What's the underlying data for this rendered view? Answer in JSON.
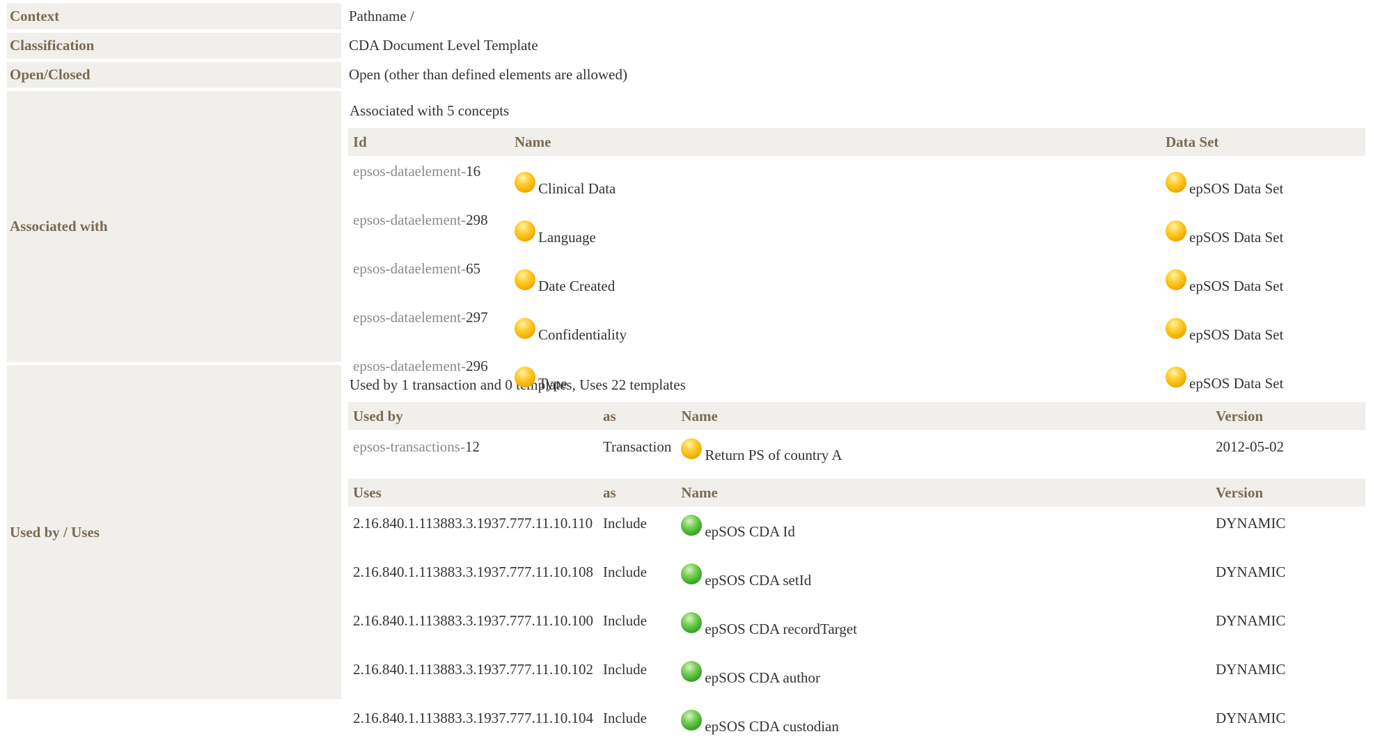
{
  "context": {
    "label": "Context",
    "value": "Pathname /"
  },
  "classification": {
    "label": "Classification",
    "value": "CDA Document Level Template"
  },
  "open_closed": {
    "label": "Open/Closed",
    "value": "Open (other than defined elements are allowed)"
  },
  "associated": {
    "label": "Associated with",
    "intro": "Associated with 5 concepts",
    "headers": {
      "id": "Id",
      "name": "Name",
      "dataset": "Data Set"
    },
    "rows": [
      {
        "id_prefix": "epsos-dataelement-",
        "id_num": "16",
        "name": "Clinical Data",
        "dataset": "epSOS Data Set"
      },
      {
        "id_prefix": "epsos-dataelement-",
        "id_num": "298",
        "name": "Language",
        "dataset": "epSOS Data Set"
      },
      {
        "id_prefix": "epsos-dataelement-",
        "id_num": "65",
        "name": "Date Created",
        "dataset": "epSOS Data Set"
      },
      {
        "id_prefix": "epsos-dataelement-",
        "id_num": "297",
        "name": "Confidentiality",
        "dataset": "epSOS Data Set"
      },
      {
        "id_prefix": "epsos-dataelement-",
        "id_num": "296",
        "name": "Type",
        "dataset": "epSOS Data Set"
      }
    ]
  },
  "used_by_uses": {
    "label": "Used by / Uses",
    "intro": "Used by 1 transaction and 0 templates, Uses 22 templates",
    "used_by_headers": {
      "col1": "Used by",
      "as": "as",
      "name": "Name",
      "version": "Version"
    },
    "used_by_rows": [
      {
        "id_prefix": "epsos-transactions-",
        "id_num": "12",
        "as": "Transaction",
        "name": "Return PS of country A",
        "version": "2012-05-02"
      }
    ],
    "uses_headers": {
      "col1": "Uses",
      "as": "as",
      "name": "Name",
      "version": "Version"
    },
    "uses_rows": [
      {
        "id": "2.16.840.1.113883.3.1937.777.11.10.110",
        "as": "Include",
        "name": "epSOS CDA Id",
        "version": "DYNAMIC"
      },
      {
        "id": "2.16.840.1.113883.3.1937.777.11.10.108",
        "as": "Include",
        "name": "epSOS CDA setId",
        "version": "DYNAMIC"
      },
      {
        "id": "2.16.840.1.113883.3.1937.777.11.10.100",
        "as": "Include",
        "name": "epSOS CDA recordTarget",
        "version": "DYNAMIC"
      },
      {
        "id": "2.16.840.1.113883.3.1937.777.11.10.102",
        "as": "Include",
        "name": "epSOS CDA author",
        "version": "DYNAMIC"
      },
      {
        "id": "2.16.840.1.113883.3.1937.777.11.10.104",
        "as": "Include",
        "name": "epSOS CDA custodian",
        "version": "DYNAMIC"
      }
    ]
  },
  "colors": {
    "label_bg": "#f0efec",
    "label_text": "#7a6a52",
    "muted_id": "#8b8b8b",
    "ball_orange": "#f4b200",
    "ball_green": "#3aa52b"
  },
  "icons": {
    "concept": "orange-ball-icon",
    "template": "green-ball-icon"
  }
}
